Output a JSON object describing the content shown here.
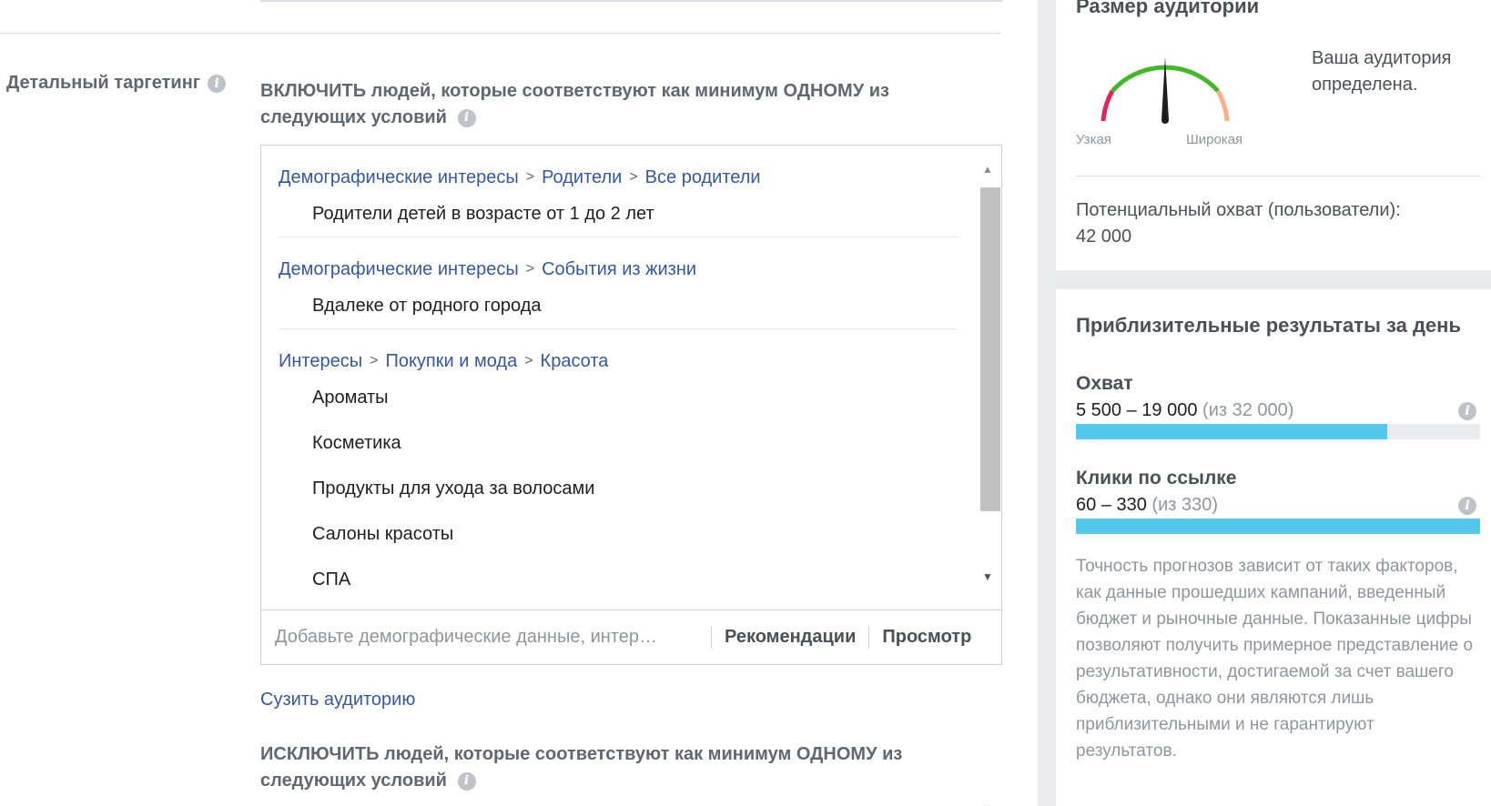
{
  "detailed_targeting": {
    "label": "Детальный таргетинг",
    "include_text": "ВКЛЮЧИТЬ людей, которые соответствуют как минимум ОДНОМУ из следующих условий",
    "groups": [
      {
        "crumbs": [
          "Демографические интересы",
          "Родители",
          "Все родители"
        ],
        "items": [
          "Родители детей в возрасте от 1 до 2 лет"
        ]
      },
      {
        "crumbs": [
          "Демографические интересы",
          "События из жизни"
        ],
        "items": [
          "Вдалеке от родного города"
        ]
      },
      {
        "crumbs": [
          "Интересы",
          "Покупки и мода",
          "Красота"
        ],
        "items": [
          "Ароматы",
          "Косметика",
          "Продукты для ухода за волосами",
          "Салоны красоты",
          "СПА"
        ]
      }
    ],
    "crumb_separator": ">",
    "search_placeholder": "Добавьте демографические данные, интер…",
    "recommendations_label": "Рекомендации",
    "browse_label": "Просмотр",
    "narrow_link": "Сузить аудиторию",
    "exclude_text": "ИСКЛЮЧИТЬ людей, которые соответствуют как минимум ОДНОМУ из следующих условий"
  },
  "audience_size": {
    "title": "Размер аудитории",
    "gauge_narrow_label": "Узкая",
    "gauge_wide_label": "Широкая",
    "description": "Ваша аудитория определена.",
    "potential_reach_label": "Потенциальный охват (пользователи):",
    "potential_reach_value": "42 000"
  },
  "daily_results": {
    "title": "Приблизительные результаты за день",
    "reach_label": "Охват",
    "reach_range": "5 500 – 19 000",
    "reach_of": "(из 32 000)",
    "reach_fill_fraction": 0.77,
    "clicks_label": "Клики по ссылке",
    "clicks_range": "60 – 330",
    "clicks_of": "(из 330)",
    "clicks_fill_fraction": 1.0,
    "disclaimer": "Точность прогнозов зависит от таких факторов, как данные прошедших кампаний, введенный бюджет и рыночные данные. Показанные цифры позволяют получить примерное представление о результативности, достигаемой за счет вашего бюджета, однако они являются лишь приблизительными и не гарантируют результатов."
  },
  "colors": {
    "link_blue": "#365899",
    "bar_fill": "#54c7ec",
    "gauge_green": "#42b72a",
    "gauge_red": "#e0245e",
    "gauge_orange": "#f7b085"
  },
  "icons": {
    "info": "info-icon",
    "scroll_up": "chevron-up-icon",
    "scroll_down": "chevron-down-icon"
  }
}
